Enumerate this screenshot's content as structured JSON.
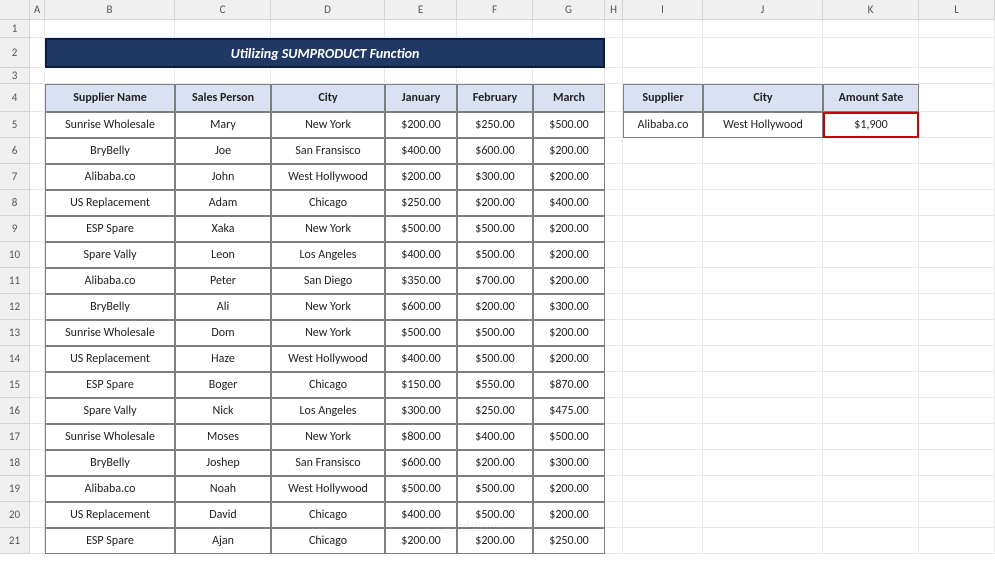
{
  "cols": [
    "A",
    "B",
    "C",
    "D",
    "E",
    "F",
    "G",
    "H",
    "I",
    "J",
    "K",
    "L"
  ],
  "rows": [
    "1",
    "2",
    "3",
    "4",
    "5",
    "6",
    "7",
    "8",
    "9",
    "10",
    "11",
    "12",
    "13",
    "14",
    "15",
    "16",
    "17",
    "18",
    "19",
    "20",
    "21"
  ],
  "title": "Utilizing SUMPRODUCT Function",
  "main_headers": [
    "Supplier Name",
    "Sales Person",
    "City",
    "January",
    "February",
    "March"
  ],
  "main_rows": [
    [
      "Sunrise Wholesale",
      "Mary",
      "New York",
      "$200.00",
      "$250.00",
      "$500.00"
    ],
    [
      "BryBelly",
      "Joe",
      "San Fransisco",
      "$400.00",
      "$600.00",
      "$200.00"
    ],
    [
      "Alibaba.co",
      "John",
      "West Hollywood",
      "$200.00",
      "$300.00",
      "$200.00"
    ],
    [
      "US Replacement",
      "Adam",
      "Chicago",
      "$250.00",
      "$200.00",
      "$400.00"
    ],
    [
      "ESP Spare",
      "Xaka",
      "New York",
      "$500.00",
      "$500.00",
      "$200.00"
    ],
    [
      "Spare Vally",
      "Leon",
      "Los Angeles",
      "$400.00",
      "$500.00",
      "$200.00"
    ],
    [
      "Alibaba.co",
      "Peter",
      "San Diego",
      "$350.00",
      "$700.00",
      "$200.00"
    ],
    [
      "BryBelly",
      "Ali",
      "New York",
      "$600.00",
      "$200.00",
      "$300.00"
    ],
    [
      "Sunrise Wholesale",
      "Dom",
      "New York",
      "$500.00",
      "$500.00",
      "$200.00"
    ],
    [
      "US Replacement",
      "Haze",
      "West Hollywood",
      "$400.00",
      "$500.00",
      "$200.00"
    ],
    [
      "ESP Spare",
      "Boger",
      "Chicago",
      "$150.00",
      "$550.00",
      "$870.00"
    ],
    [
      "Spare Vally",
      "Nick",
      "Los Angeles",
      "$300.00",
      "$250.00",
      "$475.00"
    ],
    [
      "Sunrise Wholesale",
      "Moses",
      "New York",
      "$800.00",
      "$400.00",
      "$500.00"
    ],
    [
      "BryBelly",
      "Joshep",
      "San Fransisco",
      "$600.00",
      "$200.00",
      "$300.00"
    ],
    [
      "Alibaba.co",
      "Noah",
      "West Hollywood",
      "$500.00",
      "$500.00",
      "$200.00"
    ],
    [
      "US Replacement",
      "David",
      "Chicago",
      "$400.00",
      "$500.00",
      "$200.00"
    ],
    [
      "ESP Spare",
      "Ajan",
      "Chicago",
      "$200.00",
      "$200.00",
      "$250.00"
    ]
  ],
  "side_headers": [
    "Supplier",
    "City",
    "Amount Sate"
  ],
  "side_row": [
    "Alibaba.co",
    "West Hollywood",
    "$1,900"
  ],
  "watermark": "exceldemy"
}
